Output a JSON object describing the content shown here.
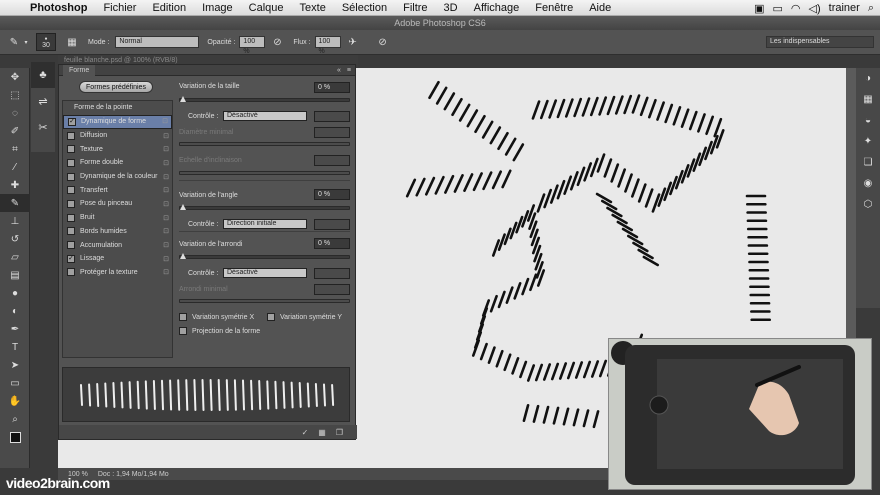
{
  "menubar": {
    "app": "Photoshop",
    "items": [
      "Fichier",
      "Edition",
      "Image",
      "Calque",
      "Texte",
      "Sélection",
      "Filtre",
      "3D",
      "Affichage",
      "Fenêtre",
      "Aide"
    ],
    "user": "trainer"
  },
  "window_title": "Adobe Photoshop CS6",
  "options": {
    "brush_size": "30",
    "mode_label": "Mode :",
    "mode_value": "Normal",
    "opacity_label": "Opacité :",
    "opacity_value": "100 %",
    "flow_label": "Flux :",
    "flow_value": "100 %",
    "workspace": "Les indispensables"
  },
  "doc_tab": "feuille blanche.psd @ 100% (RVB/8)",
  "panel": {
    "tab": "Forme",
    "preset_button": "Formes prédéfinies",
    "list_header": "Forme de la pointe",
    "items": [
      {
        "label": "Dynamique de forme",
        "checked": true,
        "selected": true
      },
      {
        "label": "Diffusion",
        "checked": false,
        "selected": false
      },
      {
        "label": "Texture",
        "checked": false,
        "selected": false
      },
      {
        "label": "Forme double",
        "checked": false,
        "selected": false
      },
      {
        "label": "Dynamique de la couleur",
        "checked": false,
        "selected": false
      },
      {
        "label": "Transfert",
        "checked": false,
        "selected": false
      },
      {
        "label": "Pose du pinceau",
        "checked": false,
        "selected": false
      },
      {
        "label": "Bruit",
        "checked": false,
        "selected": false
      },
      {
        "label": "Bords humides",
        "checked": false,
        "selected": false
      },
      {
        "label": "Accumulation",
        "checked": false,
        "selected": false
      },
      {
        "label": "Lissage",
        "checked": true,
        "selected": false
      },
      {
        "label": "Protéger la texture",
        "checked": false,
        "selected": false
      }
    ],
    "size_jitter_label": "Variation de la taille",
    "size_jitter_value": "0 %",
    "control_label": "Contrôle :",
    "control1": "Désactivé",
    "min_diameter_label": "Diamètre minimal",
    "tilt_scale_label": "Echelle d'inclinaison",
    "angle_jitter_label": "Variation de l'angle",
    "angle_jitter_value": "0 %",
    "control2": "Direction initiale",
    "roundness_jitter_label": "Variation de l'arrondi",
    "roundness_jitter_value": "0 %",
    "control3": "Désactivé",
    "min_roundness_label": "Arrondi minimal",
    "flip_x_label": "Variation symétrie X",
    "flip_y_label": "Variation symétrie Y",
    "projection_label": "Projection de la forme"
  },
  "status": {
    "zoom": "100 %",
    "doc": "Doc : 1,94 Mo/1,94 Mo"
  },
  "watermark": "video2brain.com",
  "colors": {
    "canvas": "#e9e9e9",
    "panel": "#535353",
    "selection": "#6a7fa8"
  }
}
